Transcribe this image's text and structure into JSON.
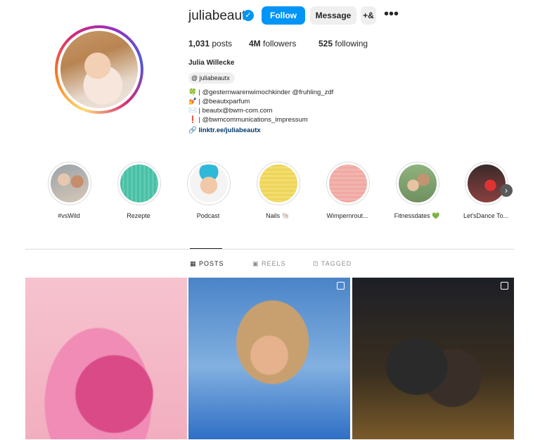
{
  "header": {
    "username": "juliabeautx",
    "follow_label": "Follow",
    "message_label": "Message",
    "add_user_glyph": "+&",
    "more_glyph": "•••",
    "verified_glyph": "✓"
  },
  "stats": {
    "posts_count": "1,031",
    "posts_label": "posts",
    "followers_count": "4M",
    "followers_label": "followers",
    "following_count": "525",
    "following_label": "following"
  },
  "profile": {
    "full_name": "Julia Willecke",
    "threads_handle": "juliabeautx",
    "bio_lines": [
      "🍀 | @gesternwarenwimochkinder @fruhling_zdf",
      "💅 | @beautxparfum",
      "✉️ | beautx@bwm-com.com",
      "❗ | @bwmcommunications_impressum"
    ],
    "link": "linktr.ee/juliabeautx"
  },
  "highlights": [
    {
      "label": "#vsWild"
    },
    {
      "label": "Rezepte"
    },
    {
      "label": "Podcast"
    },
    {
      "label": "Nails 🐚"
    },
    {
      "label": "Wimpernrout..."
    },
    {
      "label": "Fitnessdates 💚"
    },
    {
      "label": "Let'sDance To..."
    }
  ],
  "tabs": {
    "posts": "POSTS",
    "reels": "REELS",
    "tagged": "TAGGED"
  },
  "colors": {
    "accent": "#0095f6",
    "link": "#00376b"
  }
}
